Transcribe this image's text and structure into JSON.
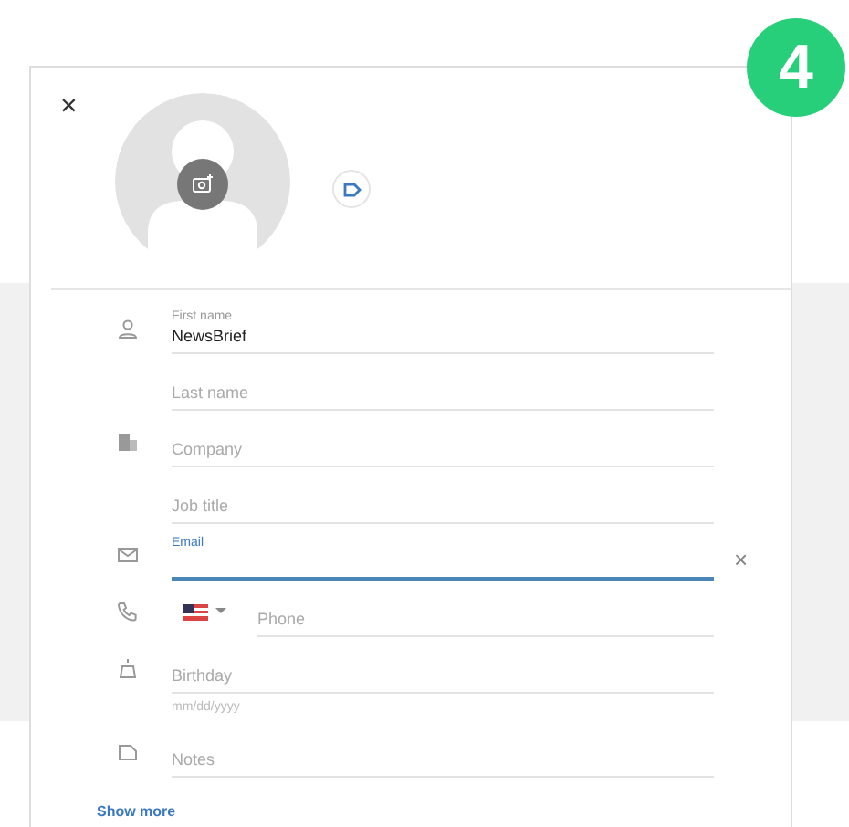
{
  "badge": "4",
  "dialog": {
    "close": "×",
    "fields": [
      {
        "kind": "text",
        "label": "First name",
        "value": "NewsBrief",
        "focused": false
      },
      {
        "kind": "text",
        "placeholder": "Last name",
        "focused": false
      },
      {
        "kind": "text",
        "placeholder": "Company",
        "focused": false
      },
      {
        "kind": "text",
        "placeholder": "Job title",
        "focused": false
      },
      {
        "kind": "text",
        "label": "Email",
        "focused": true,
        "clear": "×"
      },
      {
        "kind": "phone",
        "placeholder": "Phone",
        "focused": false
      },
      {
        "kind": "date",
        "placeholder": "Birthday",
        "hint": "mm/dd/yyyy",
        "focused": false
      },
      {
        "kind": "text",
        "placeholder": "Notes",
        "focused": false
      }
    ],
    "show_more": "Show more"
  }
}
